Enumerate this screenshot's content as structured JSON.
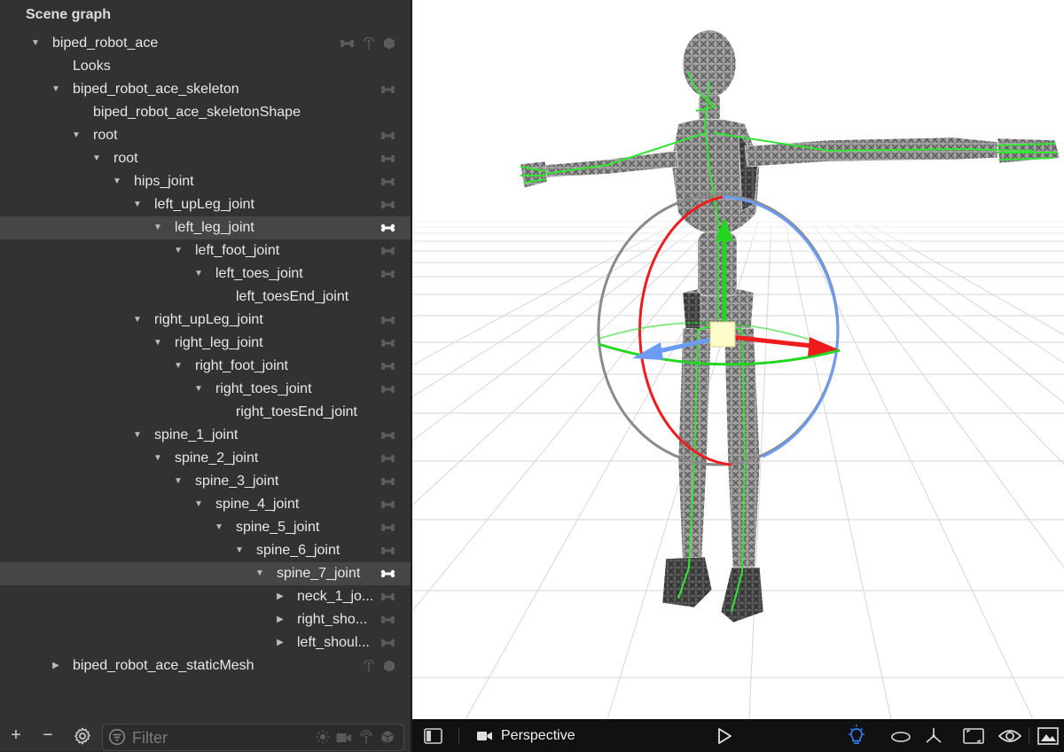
{
  "panel": {
    "title": "Scene graph"
  },
  "tree": [
    {
      "label": "biped_robot_ace",
      "toggle": "expanded",
      "depth": 0,
      "icons": [
        "bone",
        "light",
        "cube"
      ]
    },
    {
      "label": "Looks",
      "toggle": "none",
      "depth": 1,
      "icons": []
    },
    {
      "label": "biped_robot_ace_skeleton",
      "toggle": "expanded",
      "depth": 1,
      "icons": [
        "bone"
      ]
    },
    {
      "label": "biped_robot_ace_skeletonShape",
      "toggle": "none",
      "depth": 2,
      "icons": []
    },
    {
      "label": "root",
      "toggle": "expanded",
      "depth": 2,
      "icons": [
        "bone"
      ]
    },
    {
      "label": "root",
      "toggle": "expanded",
      "depth": 3,
      "icons": [
        "bone"
      ]
    },
    {
      "label": "hips_joint",
      "toggle": "expanded",
      "depth": 4,
      "icons": [
        "bone"
      ]
    },
    {
      "label": "left_upLeg_joint",
      "toggle": "expanded",
      "depth": 5,
      "icons": [
        "bone"
      ]
    },
    {
      "label": "left_leg_joint",
      "toggle": "expanded",
      "depth": 6,
      "icons": [
        "bone"
      ],
      "selected": true
    },
    {
      "label": "left_foot_joint",
      "toggle": "expanded",
      "depth": 7,
      "icons": [
        "bone"
      ]
    },
    {
      "label": "left_toes_joint",
      "toggle": "expanded",
      "depth": 8,
      "icons": [
        "bone"
      ]
    },
    {
      "label": "left_toesEnd_joint",
      "toggle": "none",
      "depth": 9,
      "icons": []
    },
    {
      "label": "right_upLeg_joint",
      "toggle": "expanded",
      "depth": 5,
      "icons": [
        "bone"
      ]
    },
    {
      "label": "right_leg_joint",
      "toggle": "expanded",
      "depth": 6,
      "icons": [
        "bone"
      ]
    },
    {
      "label": "right_foot_joint",
      "toggle": "expanded",
      "depth": 7,
      "icons": [
        "bone"
      ]
    },
    {
      "label": "right_toes_joint",
      "toggle": "expanded",
      "depth": 8,
      "icons": [
        "bone"
      ]
    },
    {
      "label": "right_toesEnd_joint",
      "toggle": "none",
      "depth": 9,
      "icons": []
    },
    {
      "label": "spine_1_joint",
      "toggle": "expanded",
      "depth": 5,
      "icons": [
        "bone"
      ]
    },
    {
      "label": "spine_2_joint",
      "toggle": "expanded",
      "depth": 6,
      "icons": [
        "bone"
      ]
    },
    {
      "label": "spine_3_joint",
      "toggle": "expanded",
      "depth": 7,
      "icons": [
        "bone"
      ]
    },
    {
      "label": "spine_4_joint",
      "toggle": "expanded",
      "depth": 8,
      "icons": [
        "bone"
      ]
    },
    {
      "label": "spine_5_joint",
      "toggle": "expanded",
      "depth": 9,
      "icons": [
        "bone"
      ]
    },
    {
      "label": "spine_6_joint",
      "toggle": "expanded",
      "depth": 10,
      "icons": [
        "bone"
      ]
    },
    {
      "label": "spine_7_joint",
      "toggle": "expanded",
      "depth": 11,
      "icons": [
        "bone"
      ],
      "selected": true
    },
    {
      "label": "neck_1_jo...",
      "toggle": "collapsed",
      "depth": 12,
      "icons": [
        "bone"
      ]
    },
    {
      "label": "right_sho...",
      "toggle": "collapsed",
      "depth": 12,
      "icons": [
        "bone"
      ]
    },
    {
      "label": "left_shoul...",
      "toggle": "collapsed",
      "depth": 12,
      "icons": [
        "bone"
      ]
    },
    {
      "label": "biped_robot_ace_staticMesh",
      "toggle": "collapsed",
      "depth": 1,
      "icons": [
        "light",
        "cube"
      ]
    }
  ],
  "bottom_bar": {
    "add_label": "+",
    "remove_label": "−",
    "settings_icon": "gear-icon",
    "filter_placeholder": "Filter",
    "filter_value": "",
    "filter_icons": [
      "sun-icon",
      "camera-icon",
      "broadcast-icon",
      "cube-icon"
    ]
  },
  "viewport": {
    "camera_label": "Perspective",
    "colors": {
      "x_axis": "#ee1c1c",
      "y_axis": "#22d622",
      "z_axis": "#6b9cf2",
      "skeleton": "#33e533",
      "highlight": "#2f7df6"
    }
  }
}
